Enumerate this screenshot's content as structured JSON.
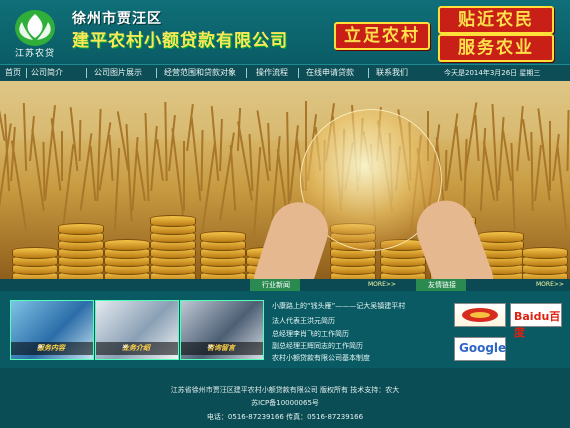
{
  "header": {
    "logo_text": "江苏农贷",
    "city": "徐州市贾汪区",
    "company": "建平农村小额贷款有限公司",
    "slogan_left": "立足农村",
    "slogan_right_top": "贴近农民",
    "slogan_right_bottom": "服务农业"
  },
  "nav": {
    "items": [
      "首页",
      "公司简介",
      "公司图片展示",
      "经营范围和贷款对象",
      "操作流程",
      "在线申请贷款",
      "联系我们"
    ],
    "date": "今天是2014年3月26日 星期三"
  },
  "sections": {
    "news_title": "行业新闻",
    "news_more": "MORE>>",
    "links_title": "友情链接",
    "links_more": "MORE>>"
  },
  "photos": [
    {
      "caption": "服务内容"
    },
    {
      "caption": "业务介绍"
    },
    {
      "caption": "咨询留言"
    }
  ],
  "news": [
    "小康路上的“钱头雁”———记大吴镇建平村",
    "法人代表王洪元简历",
    "总经理李肖飞的工作简历",
    "副总经理王辉同志的工作简历",
    "农村小额贷款有限公司基本制度"
  ],
  "links": [
    {
      "name": "red-logo"
    },
    {
      "name": "Baidu百度"
    },
    {
      "name": "Google"
    }
  ],
  "footer": {
    "line1": "江苏省徐州市贾汪区建平农村小额贷款有限公司  版权所有  技术支持：农大",
    "line2": "苏ICP备10000065号",
    "line3": "电话：0516-87239166  传真：0516-87239166"
  },
  "colors": {
    "bg": "#0b5a63",
    "title_yellow": "#fde65a",
    "stamp_red": "#c81f16"
  }
}
